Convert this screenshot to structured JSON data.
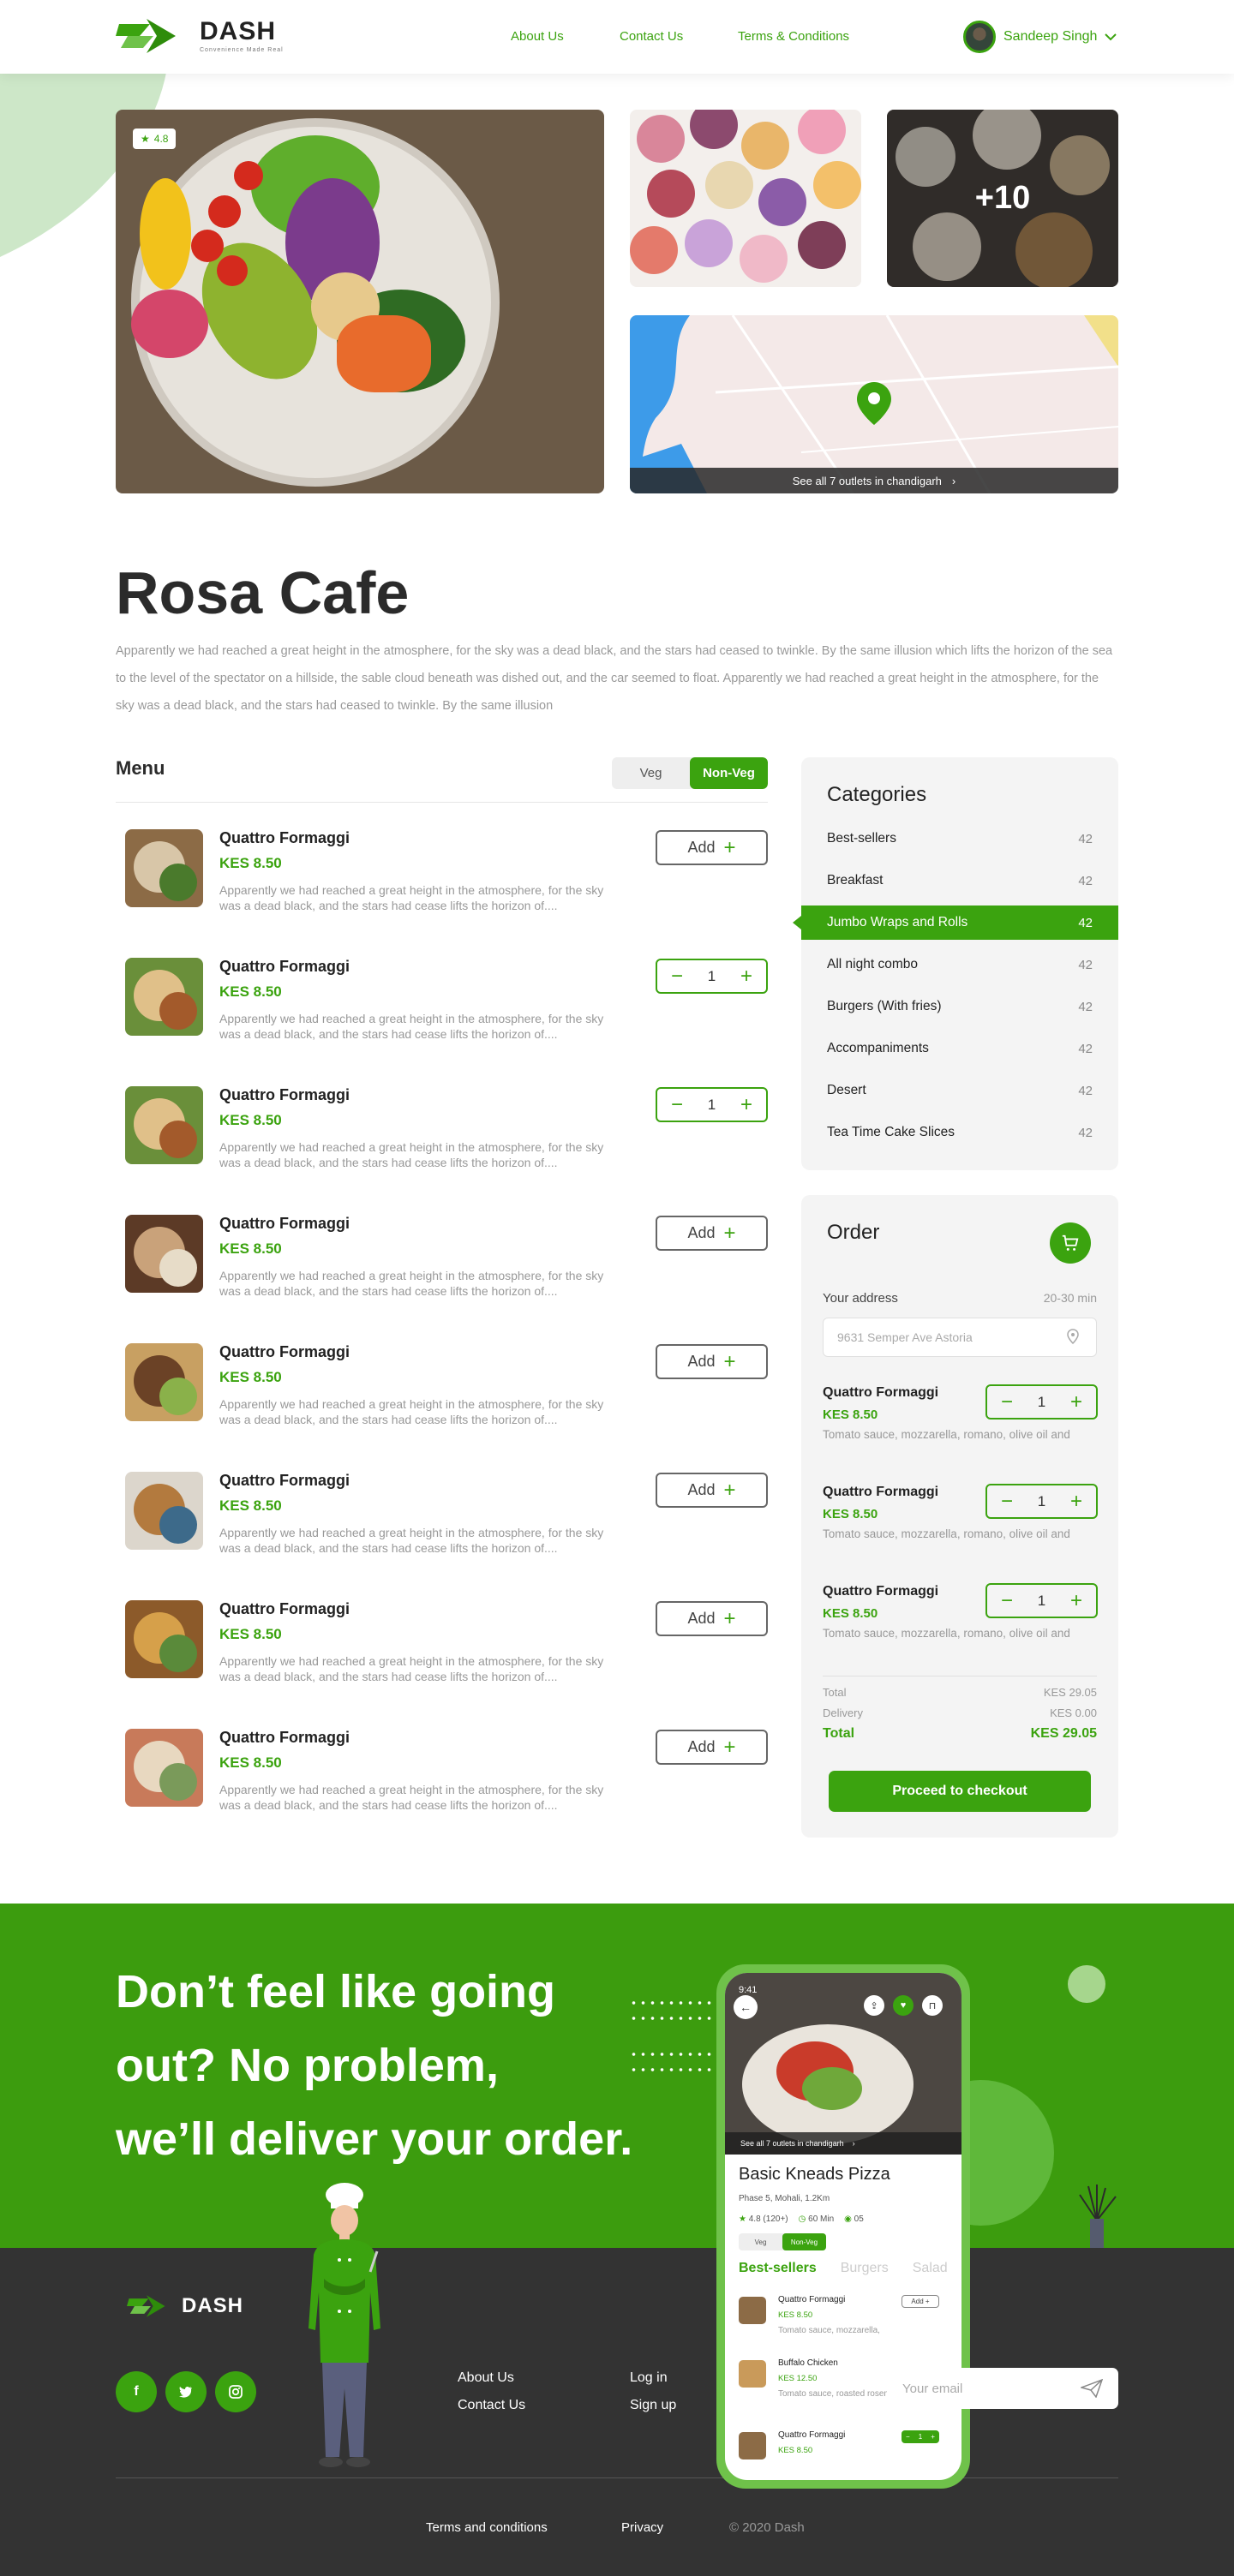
{
  "brand": {
    "name": "DASH",
    "tagline": "Convenience Made Real",
    "accent": "#3ba30f"
  },
  "nav": {
    "about": "About Us",
    "contact": "Contact Us",
    "terms": "Terms & Conditions"
  },
  "user": {
    "name": "Sandeep Singh"
  },
  "gallery": {
    "rating": "4.8",
    "more_photos": "+10",
    "outlets": "See all 7 outlets in chandigarh"
  },
  "restaurant": {
    "name": "Rosa Cafe",
    "description": "Apparently we had reached a great height in the atmosphere, for the sky was a dead black, and the stars had ceased to twinkle. By the same illusion which lifts the horizon of the sea to the level of the spectator on a hillside, the sable cloud beneath was dished out, and the car seemed to float. Apparently we had reached a great height in the atmosphere, for the sky was a dead black, and the stars had ceased to twinkle. By the same illusion"
  },
  "menu": {
    "heading": "Menu",
    "toggle": {
      "veg": "Veg",
      "nonveg": "Non-Veg",
      "selected": "Non-Veg"
    },
    "add_label": "Add",
    "items": [
      {
        "name": "Quattro Formaggi",
        "price": "KES 8.50",
        "desc": "Apparently we had reached a great height in the atmosphere, for the sky was a dead black, and the stars had cease lifts the horizon of....",
        "qty": null
      },
      {
        "name": "Quattro Formaggi",
        "price": "KES 8.50",
        "desc": "Apparently we had reached a great height in the atmosphere, for the sky was a dead black, and the stars had cease lifts the horizon of....",
        "qty": "1"
      },
      {
        "name": "Quattro Formaggi",
        "price": "KES 8.50",
        "desc": "Apparently we had reached a great height in the atmosphere, for the sky was a dead black, and the stars had cease lifts the horizon of....",
        "qty": "1"
      },
      {
        "name": "Quattro Formaggi",
        "price": "KES 8.50",
        "desc": "Apparently we had reached a great height in the atmosphere, for the sky was a dead black, and the stars had cease lifts the horizon of....",
        "qty": null
      },
      {
        "name": "Quattro Formaggi",
        "price": "KES 8.50",
        "desc": "Apparently we had reached a great height in the atmosphere, for the sky was a dead black, and the stars had cease lifts the horizon of....",
        "qty": null
      },
      {
        "name": "Quattro Formaggi",
        "price": "KES 8.50",
        "desc": "Apparently we had reached a great height in the atmosphere, for the sky was a dead black, and the stars had cease lifts the horizon of....",
        "qty": null
      },
      {
        "name": "Quattro Formaggi",
        "price": "KES 8.50",
        "desc": "Apparently we had reached a great height in the atmosphere, for the sky was a dead black, and the stars had cease lifts the horizon of....",
        "qty": null
      },
      {
        "name": "Quattro Formaggi",
        "price": "KES 8.50",
        "desc": "Apparently we had reached a great height in the atmosphere, for the sky was a dead black, and the stars had cease lifts the horizon of....",
        "qty": null
      }
    ]
  },
  "categories": {
    "title": "Categories",
    "active": "Jumbo Wraps and Rolls",
    "items": [
      {
        "label": "Best-sellers",
        "count": "42"
      },
      {
        "label": "Breakfast",
        "count": "42"
      },
      {
        "label": "Jumbo Wraps and Rolls",
        "count": "42"
      },
      {
        "label": "All night combo",
        "count": "42"
      },
      {
        "label": "Burgers (With fries)",
        "count": "42"
      },
      {
        "label": "Accompaniments",
        "count": "42"
      },
      {
        "label": "Desert",
        "count": "42"
      },
      {
        "label": "Tea Time Cake Slices",
        "count": "42"
      }
    ]
  },
  "order": {
    "title": "Order",
    "address_label": "Your address",
    "eta": "20-30 min",
    "address_value": "9631 Semper Ave Astoria",
    "items": [
      {
        "name": "Quattro Formaggi",
        "price": "KES 8.50",
        "desc": "Tomato sauce, mozzarella, romano, olive oil and",
        "qty": "1"
      },
      {
        "name": "Quattro Formaggi",
        "price": "KES 8.50",
        "desc": "Tomato sauce, mozzarella, romano, olive oil and",
        "qty": "1"
      },
      {
        "name": "Quattro Formaggi",
        "price": "KES 8.50",
        "desc": "Tomato sauce, mozzarella, romano, olive oil and",
        "qty": "1"
      }
    ],
    "summary": {
      "total_label": "Total",
      "total_value": "KES 29.05",
      "delivery_label": "Delivery",
      "delivery_value": "KES 0.00",
      "grand_label": "Total",
      "grand_value": "KES 29.05"
    },
    "checkout": "Proceed to checkout"
  },
  "promo": {
    "line1": "Don’t feel like going",
    "line2": "out? No problem,",
    "line3": "we’ll deliver your order."
  },
  "phone": {
    "time": "9:41",
    "outlets": "See all 7 outlets in chandigarh",
    "restaurant": "Basic Kneads Pizza",
    "address": "Phase 5, Mohali, 1.2Km",
    "rating": "4.8 (120+)",
    "time_estimate": "60 Min",
    "cost": "05",
    "veg": "Veg",
    "nonveg": "Non-Veg",
    "tabs": [
      "Best-sellers",
      "Burgers",
      "Salad"
    ],
    "add": "Add +",
    "items": [
      {
        "name": "Quattro Formaggi",
        "price": "KES 8.50",
        "desc": "Tomato sauce, mozzarella,"
      },
      {
        "name": "Buffalo Chicken",
        "price": "KES 12.50",
        "desc": "Tomato sauce, roasted rosemary"
      },
      {
        "name": "Quattro Formaggi",
        "price": "KES 8.50",
        "desc": ""
      }
    ],
    "stepper_qty": "1"
  },
  "footer": {
    "brand": "DASH",
    "links": {
      "about": "About Us",
      "contact": "Contact Us",
      "login": "Log in",
      "signup": "Sign up"
    },
    "email_placeholder": "Your email",
    "bottom": {
      "terms": "Terms and conditions",
      "privacy": "Privacy",
      "copyright": "© 2020 Dash"
    },
    "socials": [
      "facebook",
      "twitter",
      "instagram"
    ]
  }
}
